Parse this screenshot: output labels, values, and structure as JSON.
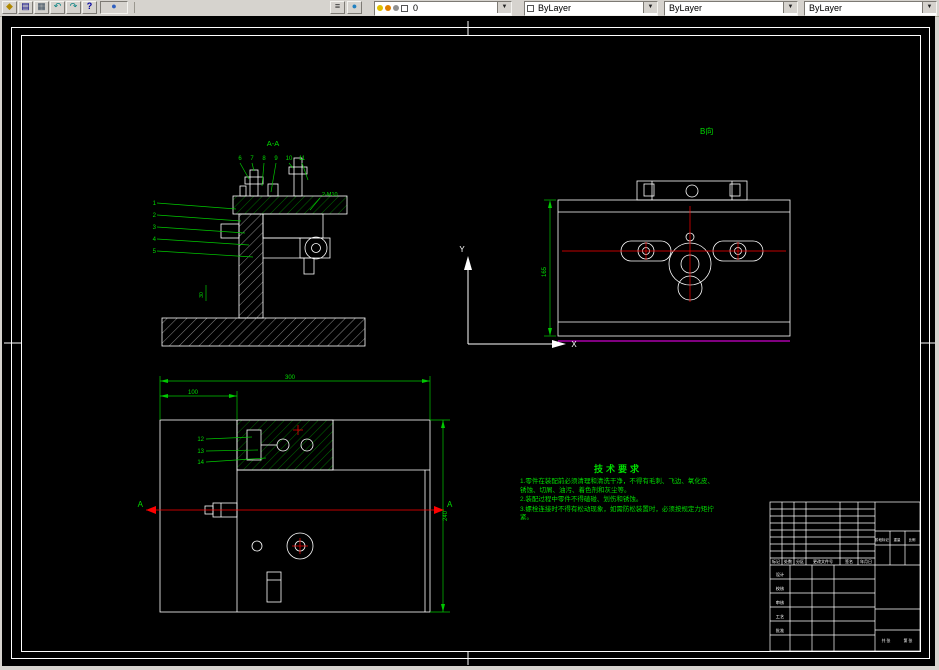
{
  "toolbar": {
    "icons": [
      {
        "name": "open",
        "glyph": "◆",
        "color": "#b08800"
      },
      {
        "name": "save",
        "glyph": "▤",
        "color": "#000080"
      },
      {
        "name": "print",
        "glyph": "▦",
        "color": "#405060"
      },
      {
        "name": "undo",
        "glyph": "↶",
        "color": "#008080"
      },
      {
        "name": "redo",
        "glyph": "↷",
        "color": "#008080"
      },
      {
        "name": "help",
        "glyph": "?",
        "color": "#0000a0"
      },
      {
        "name": "properties",
        "glyph": "●",
        "color": "#3060c0"
      },
      {
        "name": "layers",
        "glyph": "≡",
        "color": "#303030"
      },
      {
        "name": "layer-states",
        "glyph": "●",
        "color": "#2080c0"
      }
    ],
    "combos": [
      {
        "name": "layer",
        "value": "0"
      },
      {
        "name": "color",
        "value": "ByLayer"
      },
      {
        "name": "linetype",
        "value": "ByLayer"
      },
      {
        "name": "lineweight",
        "value": "ByLayer"
      }
    ]
  },
  "views": {
    "front": {
      "label": "A-A",
      "balloons_left": [
        "1",
        "2",
        "3",
        "4",
        "5"
      ],
      "balloons_top": [
        "6",
        "7",
        "8",
        "9",
        "10",
        "11"
      ],
      "thread_callout": "2-M10",
      "dim": "30"
    },
    "b_view": {
      "label": "B向",
      "dim_height": "165"
    },
    "plan": {
      "dim_total": "300",
      "dim_left": "100",
      "dim_side": "240",
      "section_a_left": "A",
      "section_a_right": "A",
      "balloons": [
        "12",
        "13",
        "14"
      ]
    },
    "ucs": {
      "x_label": "X",
      "y_label": "Y"
    }
  },
  "tech_req": {
    "title": "技术要求",
    "items": [
      "1.零件在装配前必须清理和清洗干净，不得有毛刺、飞边、氧化皮、锈蚀、切屑、油污、着色剂和灰尘等。",
      "2.装配过程中零件不得磕碰、划伤和锈蚀。",
      "3.螺栓连接时不得有松动现象，如需防松装置时，必须按规定力矩拧紧。"
    ]
  },
  "title_block": {
    "rev_cols": [
      "标记",
      "处数",
      "分区",
      "更改文件号",
      "签名",
      "年月日"
    ],
    "roles": [
      "设计",
      "校核",
      "审核",
      "工艺",
      "批准"
    ],
    "stage": "阶段标记",
    "weight": "重量",
    "scale": "比例",
    "sheet_total": "共 张",
    "sheet_no": "第 张"
  },
  "colors": {
    "line": "#ffffff",
    "dim_green": "#00c800",
    "text_green": "#00dd00",
    "accent_red": "#ff0000",
    "magenta": "#ff00ff"
  }
}
